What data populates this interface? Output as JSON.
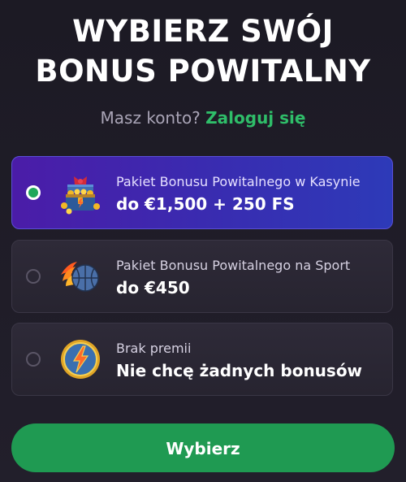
{
  "header": {
    "title_line1": "WYBIERZ SWÓJ",
    "title_line2": "BONUS POWITALNY"
  },
  "login": {
    "prompt": "Masz konto?",
    "link_label": "Zaloguj się"
  },
  "options": [
    {
      "subtitle": "Pakiet Bonusu Powitalnego w Kasynie",
      "title": "do €1,500 + 250 FS",
      "icon": "treasure-chest-icon",
      "selected": true
    },
    {
      "subtitle": "Pakiet Bonusu Powitalnego na Sport",
      "title": "do €450",
      "icon": "flaming-basketball-icon",
      "selected": false
    },
    {
      "subtitle": "Brak premii",
      "title": "Nie chcę żadnych bonusów",
      "icon": "no-bonus-lightning-icon",
      "selected": false
    }
  ],
  "cta": {
    "label": "Wybierz"
  },
  "colors": {
    "background": "#1f1d27",
    "accent_green": "#1f9a52",
    "link_green": "#2fbd69",
    "selected_card_start": "#4b1ca8",
    "selected_card_end": "#2d3ab8"
  }
}
